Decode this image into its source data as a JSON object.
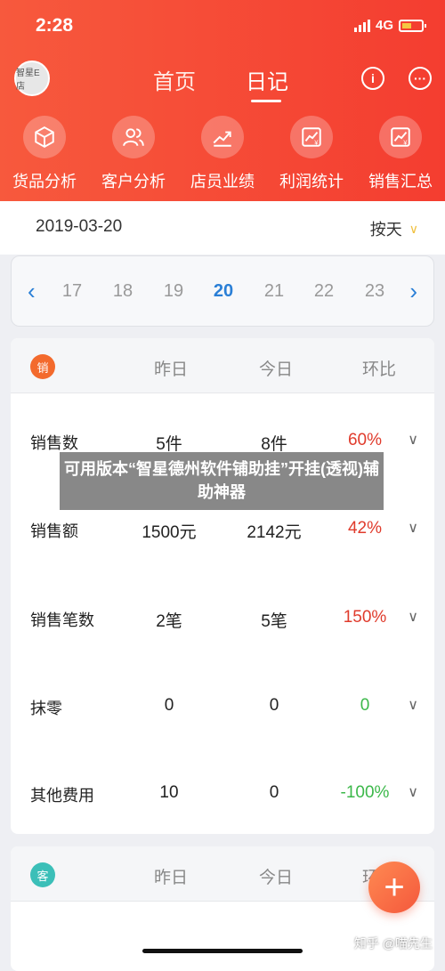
{
  "status": {
    "time": "2:28",
    "network": "4G"
  },
  "avatar": {
    "text": "智星E店"
  },
  "tabs": [
    {
      "label": "首页",
      "active": false
    },
    {
      "label": "日记",
      "active": true
    }
  ],
  "header_icons": [
    "info-icon",
    "chat-icon"
  ],
  "shortcuts": [
    {
      "label": "货品分析",
      "icon": "cube-icon"
    },
    {
      "label": "客户分析",
      "icon": "users-icon"
    },
    {
      "label": "店员业绩",
      "icon": "trend-icon"
    },
    {
      "label": "利润统计",
      "icon": "profit-chart-icon"
    },
    {
      "label": "销售汇总",
      "icon": "sales-chart-icon"
    }
  ],
  "date_bar": {
    "date": "2019-03-20",
    "mode": "按天"
  },
  "day_strip": {
    "days": [
      "17",
      "18",
      "19",
      "20",
      "21",
      "22",
      "23"
    ],
    "selected": "20"
  },
  "sales_card": {
    "badge": "销",
    "badge_color": "#f36a2d",
    "columns": [
      "昨日",
      "今日",
      "环比"
    ],
    "rows": [
      {
        "label": "销售数",
        "yesterday": "5件",
        "today": "8件",
        "ratio": "60%",
        "trend": "up"
      },
      {
        "label": "销售额",
        "yesterday": "1500元",
        "today": "2142元",
        "ratio": "42%",
        "trend": "up"
      },
      {
        "label": "销售笔数",
        "yesterday": "2笔",
        "today": "5笔",
        "ratio": "150%",
        "trend": "up"
      },
      {
        "label": "抹零",
        "yesterday": "0",
        "today": "0",
        "ratio": "0",
        "trend": "flat"
      },
      {
        "label": "其他费用",
        "yesterday": "10",
        "today": "0",
        "ratio": "-100%",
        "trend": "flat"
      }
    ]
  },
  "customer_card": {
    "badge": "客",
    "badge_color": "#3bbfb8",
    "columns": [
      "昨日",
      "今日",
      "环比"
    ]
  },
  "overlay": {
    "text": "可用版本“智星德州软件铺助挂”开挂(透视)辅助神器"
  },
  "footer": {
    "watermark": "知乎 @喵先生"
  },
  "colors": {
    "header": "#f5493a",
    "accent_blue": "#2a7fd6",
    "up": "#e03b2c",
    "flat": "#3cb84a"
  }
}
